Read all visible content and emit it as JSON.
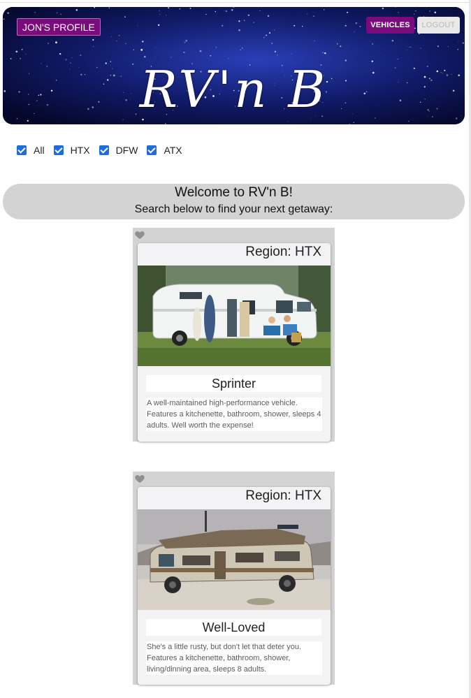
{
  "header": {
    "profile_label": "JON'S PROFILE",
    "vehicles_label": "VEHICLES",
    "logout_label": "LOGOUT",
    "logo_text": "RV'n B"
  },
  "filters": [
    {
      "label": "All",
      "checked": true
    },
    {
      "label": "HTX",
      "checked": true
    },
    {
      "label": "DFW",
      "checked": true
    },
    {
      "label": "ATX",
      "checked": true
    }
  ],
  "welcome": {
    "title": "Welcome to RV'n B!",
    "subtitle": "Search below to find your next getaway:"
  },
  "listings": [
    {
      "region": "Region: HTX",
      "name": "Sprinter",
      "description": "A well-maintained high-performance vehicle. Features a kitchenette, bathroom, shower, sleeps 4 adults. Well worth the expense!",
      "favorite_icon": "heart-icon"
    },
    {
      "region": "Region: HTX",
      "name": "Well-Loved",
      "description": "She's a little rusty, but don't let that deter you. Features a kitchenette, bathroom, shower, living/dinning area, sleeps 8 adults.",
      "favorite_icon": "heart-icon"
    }
  ],
  "colors": {
    "accent": "#7a0b7c",
    "checkbox": "#1f6dd6",
    "banner_bg": "#d3d3d3"
  }
}
